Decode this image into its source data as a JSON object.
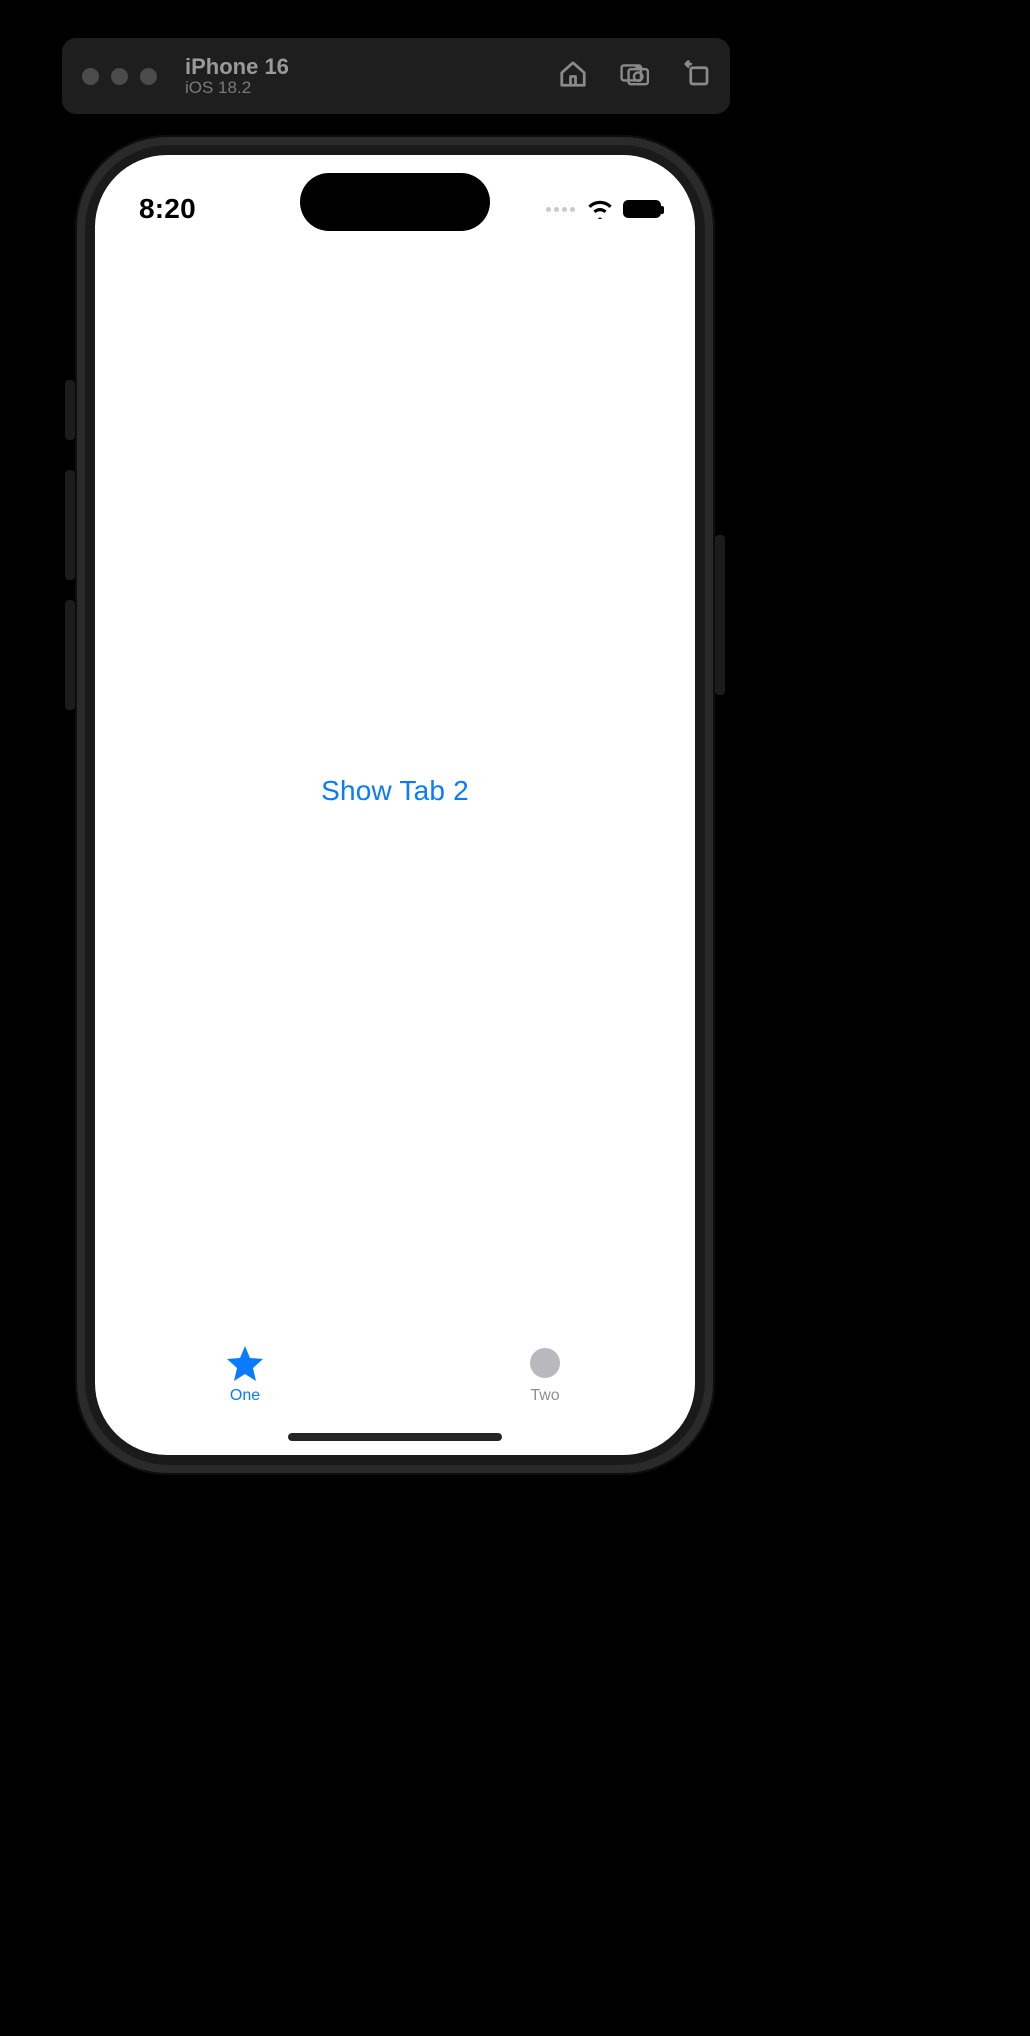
{
  "simulator": {
    "device_name": "iPhone 16",
    "os_version": "iOS 18.2",
    "actions": {
      "home": "home-icon",
      "screenshot": "screenshot-icon",
      "rotate": "rotate-icon"
    }
  },
  "status_bar": {
    "time": "8:20"
  },
  "content": {
    "button_label": "Show Tab 2"
  },
  "tab_bar": {
    "tabs": [
      {
        "label": "One",
        "icon": "star-icon",
        "active": true
      },
      {
        "label": "Two",
        "icon": "placeholder-circle-icon",
        "active": false
      }
    ]
  },
  "colors": {
    "accent": "#0a7aff",
    "inactive": "#8e8e93"
  }
}
